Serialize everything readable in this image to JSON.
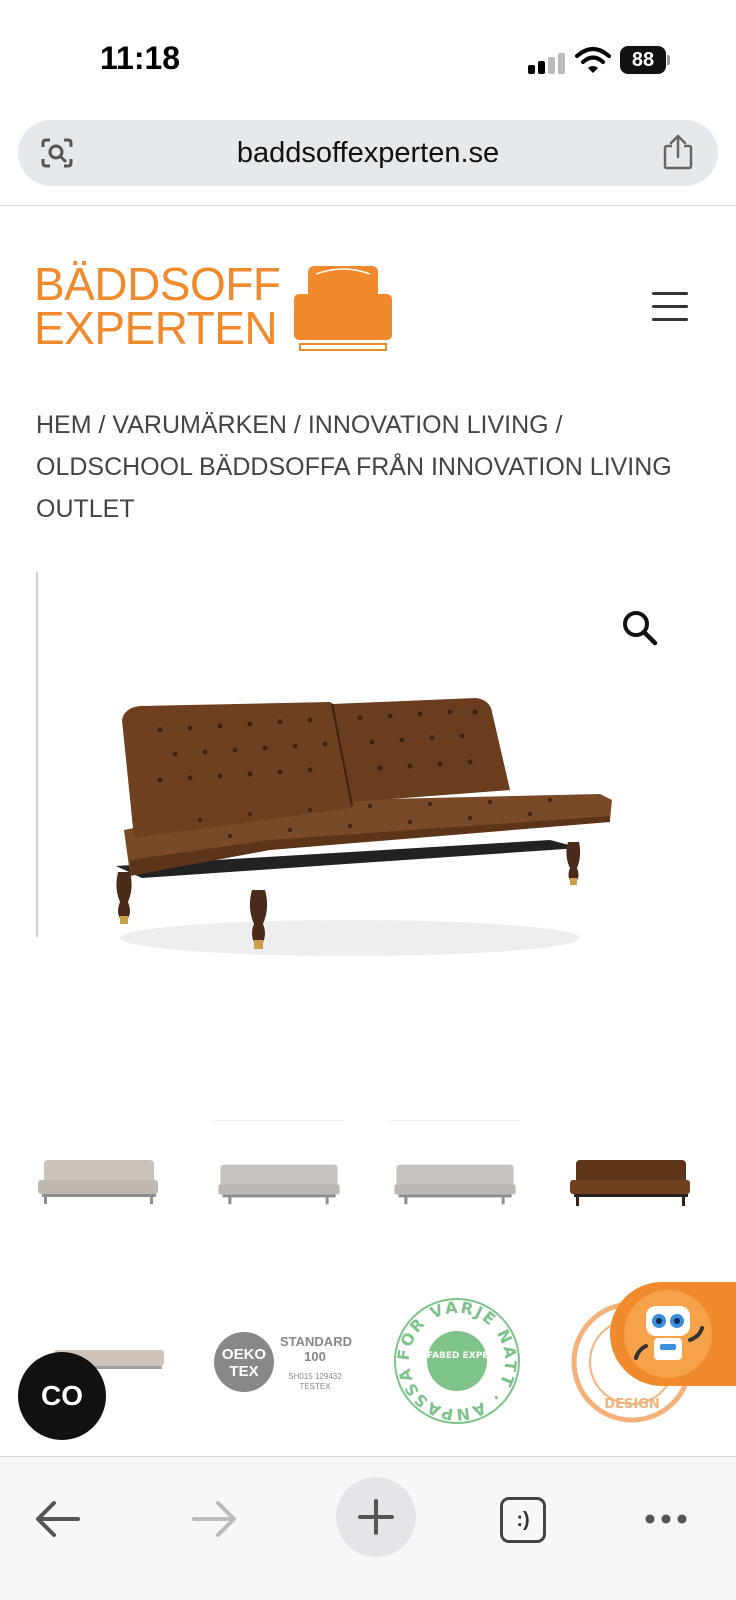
{
  "status_bar": {
    "time": "11:18",
    "battery": "88",
    "icons": [
      "signal-icon",
      "wifi-icon",
      "battery-icon"
    ]
  },
  "browser": {
    "url": "baddsoffexperten.se",
    "left_icon": "screen-search-icon",
    "right_icon": "share-icon"
  },
  "header": {
    "logo_line1": "BÄDDSOFF",
    "logo_line2": "EXPERTEN",
    "menu_icon": "hamburger-menu-icon",
    "brand_color": "#f08a2c"
  },
  "breadcrumb": {
    "items": [
      "HEM",
      "VARUMÄRKEN",
      "INNOVATION LIVING",
      "OLDSCHOOL BÄDDSOFFA FRÅN INNOVATION LIVING OUTLET"
    ],
    "separator": " / "
  },
  "product": {
    "zoom_icon": "search-zoom-icon"
  },
  "badges": {
    "oeko_logo": "OEKO TEX",
    "oeko_standard": "STANDARD 100",
    "oeko_small": "SH015 129432 TESTEX",
    "sofabed_ring": "FÖR VARJE NATT · ANPASSAD",
    "sofabed_center": "SOFABED EXPERT",
    "design_ring": "DESIGN"
  },
  "floating": {
    "co_label": "CO"
  },
  "toolbar": {
    "tabs_label": ":)",
    "icons": [
      "back-arrow-icon",
      "forward-arrow-icon",
      "new-tab-plus-icon",
      "tabs-icon",
      "more-icon"
    ]
  }
}
